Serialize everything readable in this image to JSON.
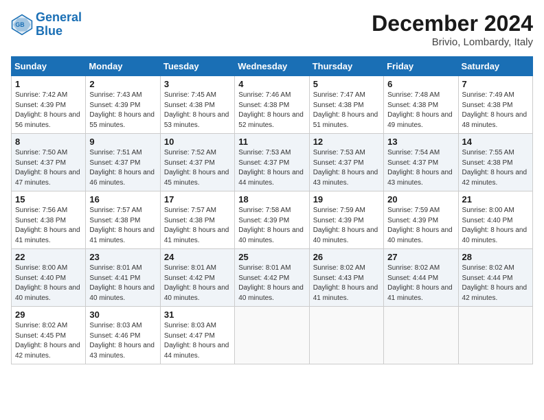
{
  "header": {
    "logo_line1": "General",
    "logo_line2": "Blue",
    "month": "December 2024",
    "location": "Brivio, Lombardy, Italy"
  },
  "weekdays": [
    "Sunday",
    "Monday",
    "Tuesday",
    "Wednesday",
    "Thursday",
    "Friday",
    "Saturday"
  ],
  "weeks": [
    [
      {
        "day": "1",
        "rise": "7:42 AM",
        "set": "4:39 PM",
        "daylight": "8 hours and 56 minutes."
      },
      {
        "day": "2",
        "rise": "7:43 AM",
        "set": "4:39 PM",
        "daylight": "8 hours and 55 minutes."
      },
      {
        "day": "3",
        "rise": "7:45 AM",
        "set": "4:38 PM",
        "daylight": "8 hours and 53 minutes."
      },
      {
        "day": "4",
        "rise": "7:46 AM",
        "set": "4:38 PM",
        "daylight": "8 hours and 52 minutes."
      },
      {
        "day": "5",
        "rise": "7:47 AM",
        "set": "4:38 PM",
        "daylight": "8 hours and 51 minutes."
      },
      {
        "day": "6",
        "rise": "7:48 AM",
        "set": "4:38 PM",
        "daylight": "8 hours and 49 minutes."
      },
      {
        "day": "7",
        "rise": "7:49 AM",
        "set": "4:38 PM",
        "daylight": "8 hours and 48 minutes."
      }
    ],
    [
      {
        "day": "8",
        "rise": "7:50 AM",
        "set": "4:37 PM",
        "daylight": "8 hours and 47 minutes."
      },
      {
        "day": "9",
        "rise": "7:51 AM",
        "set": "4:37 PM",
        "daylight": "8 hours and 46 minutes."
      },
      {
        "day": "10",
        "rise": "7:52 AM",
        "set": "4:37 PM",
        "daylight": "8 hours and 45 minutes."
      },
      {
        "day": "11",
        "rise": "7:53 AM",
        "set": "4:37 PM",
        "daylight": "8 hours and 44 minutes."
      },
      {
        "day": "12",
        "rise": "7:53 AM",
        "set": "4:37 PM",
        "daylight": "8 hours and 43 minutes."
      },
      {
        "day": "13",
        "rise": "7:54 AM",
        "set": "4:37 PM",
        "daylight": "8 hours and 43 minutes."
      },
      {
        "day": "14",
        "rise": "7:55 AM",
        "set": "4:38 PM",
        "daylight": "8 hours and 42 minutes."
      }
    ],
    [
      {
        "day": "15",
        "rise": "7:56 AM",
        "set": "4:38 PM",
        "daylight": "8 hours and 41 minutes."
      },
      {
        "day": "16",
        "rise": "7:57 AM",
        "set": "4:38 PM",
        "daylight": "8 hours and 41 minutes."
      },
      {
        "day": "17",
        "rise": "7:57 AM",
        "set": "4:38 PM",
        "daylight": "8 hours and 41 minutes."
      },
      {
        "day": "18",
        "rise": "7:58 AM",
        "set": "4:39 PM",
        "daylight": "8 hours and 40 minutes."
      },
      {
        "day": "19",
        "rise": "7:59 AM",
        "set": "4:39 PM",
        "daylight": "8 hours and 40 minutes."
      },
      {
        "day": "20",
        "rise": "7:59 AM",
        "set": "4:39 PM",
        "daylight": "8 hours and 40 minutes."
      },
      {
        "day": "21",
        "rise": "8:00 AM",
        "set": "4:40 PM",
        "daylight": "8 hours and 40 minutes."
      }
    ],
    [
      {
        "day": "22",
        "rise": "8:00 AM",
        "set": "4:40 PM",
        "daylight": "8 hours and 40 minutes."
      },
      {
        "day": "23",
        "rise": "8:01 AM",
        "set": "4:41 PM",
        "daylight": "8 hours and 40 minutes."
      },
      {
        "day": "24",
        "rise": "8:01 AM",
        "set": "4:42 PM",
        "daylight": "8 hours and 40 minutes."
      },
      {
        "day": "25",
        "rise": "8:01 AM",
        "set": "4:42 PM",
        "daylight": "8 hours and 40 minutes."
      },
      {
        "day": "26",
        "rise": "8:02 AM",
        "set": "4:43 PM",
        "daylight": "8 hours and 41 minutes."
      },
      {
        "day": "27",
        "rise": "8:02 AM",
        "set": "4:44 PM",
        "daylight": "8 hours and 41 minutes."
      },
      {
        "day": "28",
        "rise": "8:02 AM",
        "set": "4:44 PM",
        "daylight": "8 hours and 42 minutes."
      }
    ],
    [
      {
        "day": "29",
        "rise": "8:02 AM",
        "set": "4:45 PM",
        "daylight": "8 hours and 42 minutes."
      },
      {
        "day": "30",
        "rise": "8:03 AM",
        "set": "4:46 PM",
        "daylight": "8 hours and 43 minutes."
      },
      {
        "day": "31",
        "rise": "8:03 AM",
        "set": "4:47 PM",
        "daylight": "8 hours and 44 minutes."
      },
      null,
      null,
      null,
      null
    ]
  ]
}
